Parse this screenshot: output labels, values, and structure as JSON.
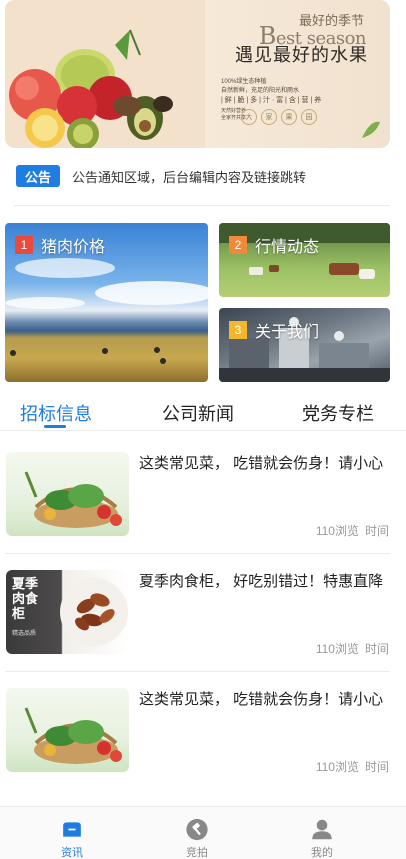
{
  "banner": {
    "tag_top": "最好的季节",
    "best_prefix": "B",
    "best_rest": "est season",
    "headline": "遇见最好的水果",
    "lines": [
      "100%绿生态种植",
      "自然新鲜，充足的阳光和雨水",
      "| 鲜 | 脆 | 多 | 汁 · 富 | 含 | 营 | 养",
      "天然好营养",
      "全家齐共享"
    ],
    "hex_chars": [
      "大",
      "家",
      "果",
      "园"
    ]
  },
  "notice": {
    "badge": "公告",
    "text": "公告通知区域，后台编辑内容及链接跳转"
  },
  "tiles": [
    {
      "num": "1",
      "label": "猪肉价格",
      "num_color": "#e84a3b"
    },
    {
      "num": "2",
      "label": "行情动态",
      "num_color": "#f08a3a"
    },
    {
      "num": "3",
      "label": "关于我们",
      "num_color": "#f2b72c"
    }
  ],
  "tabs": [
    {
      "label": "招标信息",
      "active": true
    },
    {
      "label": "公司新闻",
      "active": false
    },
    {
      "label": "党务专栏",
      "active": false
    }
  ],
  "articles": [
    {
      "title": "这类常见菜，  吃错就会伤身！请小心",
      "views": "110浏览",
      "time": "时间",
      "thumb": "vegetable-basket"
    },
    {
      "title": "夏季肉食柜，  好吃别错过！特惠直降",
      "views": "110浏览",
      "time": "时间",
      "thumb": "meat-cabinet",
      "thumb_text": [
        "夏",
        "季",
        "肉",
        "食",
        "柜"
      ],
      "thumb_sub": "精选品质"
    },
    {
      "title": "这类常见菜，  吃错就会伤身！请小心",
      "views": "110浏览",
      "time": "时间",
      "thumb": "vegetable-basket"
    }
  ],
  "nav": [
    {
      "label": "资讯",
      "icon": "news-icon",
      "active": true
    },
    {
      "label": "竞拍",
      "icon": "auction-hammer-icon",
      "active": false
    },
    {
      "label": "我的",
      "icon": "user-icon",
      "active": false
    }
  ],
  "colors": {
    "accent": "#1f7ce0",
    "muted": "#999999"
  }
}
